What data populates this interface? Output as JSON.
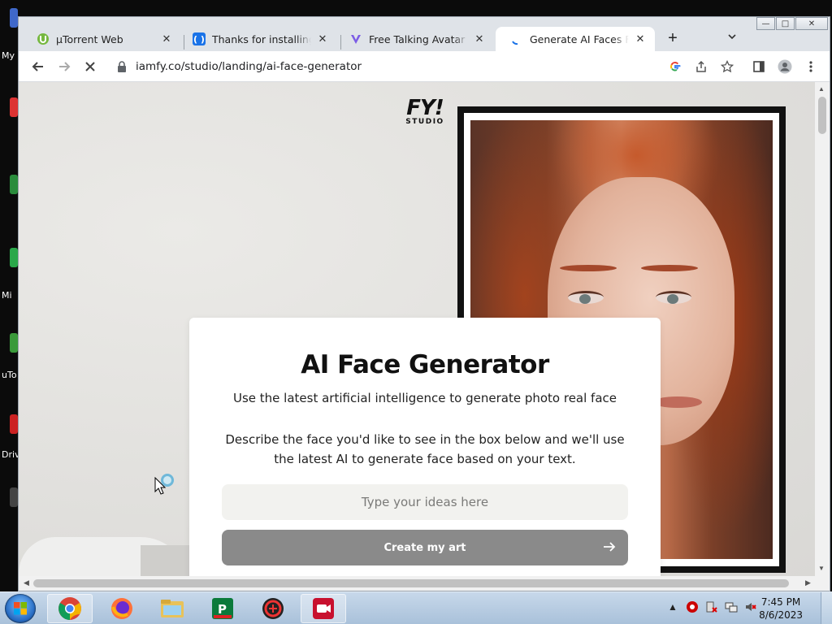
{
  "desktop": {
    "labels": [
      "My",
      "Mi",
      "uTo",
      "Driv"
    ]
  },
  "window": {
    "caption": {
      "minimize": "—",
      "maximize": "□",
      "close": "✕"
    }
  },
  "tabs": [
    {
      "title": "µTorrent Web",
      "icon": "utorrent-icon",
      "close": "✕"
    },
    {
      "title": "Thanks for installing Driv",
      "icon": "drive-icon",
      "close": "✕"
    },
    {
      "title": "Free Talking Avatar Creat",
      "icon": "avatar-app-icon",
      "close": "✕"
    },
    {
      "title": "Generate AI Faces For F",
      "icon": "loading-icon",
      "close": "✕",
      "active": true
    }
  ],
  "tabstrip": {
    "new_tab": "+",
    "search_tabs": "⌄"
  },
  "toolbar": {
    "back": "←",
    "forward": "→",
    "reload": "✕",
    "url": "iamfy.co/studio/landing/ai-face-generator"
  },
  "page": {
    "logo_main": "FY!",
    "logo_sub": "STUDIO",
    "card": {
      "title": "AI Face Generator",
      "subtitle": "Use the latest artificial intelligence to generate photo real face",
      "description": "Describe the face you'd like to see in the box below and we'll use the latest AI to generate face based on your text.",
      "input_placeholder": "Type your ideas here",
      "button_label": "Create my art"
    }
  },
  "taskbar": {
    "apps": [
      "chrome",
      "firefox",
      "file-explorer",
      "pdf-app",
      "game-app",
      "recorder-app"
    ],
    "time": "7:45 PM",
    "date": "8/6/2023"
  },
  "colors": {
    "button_bg": "#8a8a8a",
    "input_bg": "#f2f2ef",
    "page_bg": "#e7e6e3"
  }
}
